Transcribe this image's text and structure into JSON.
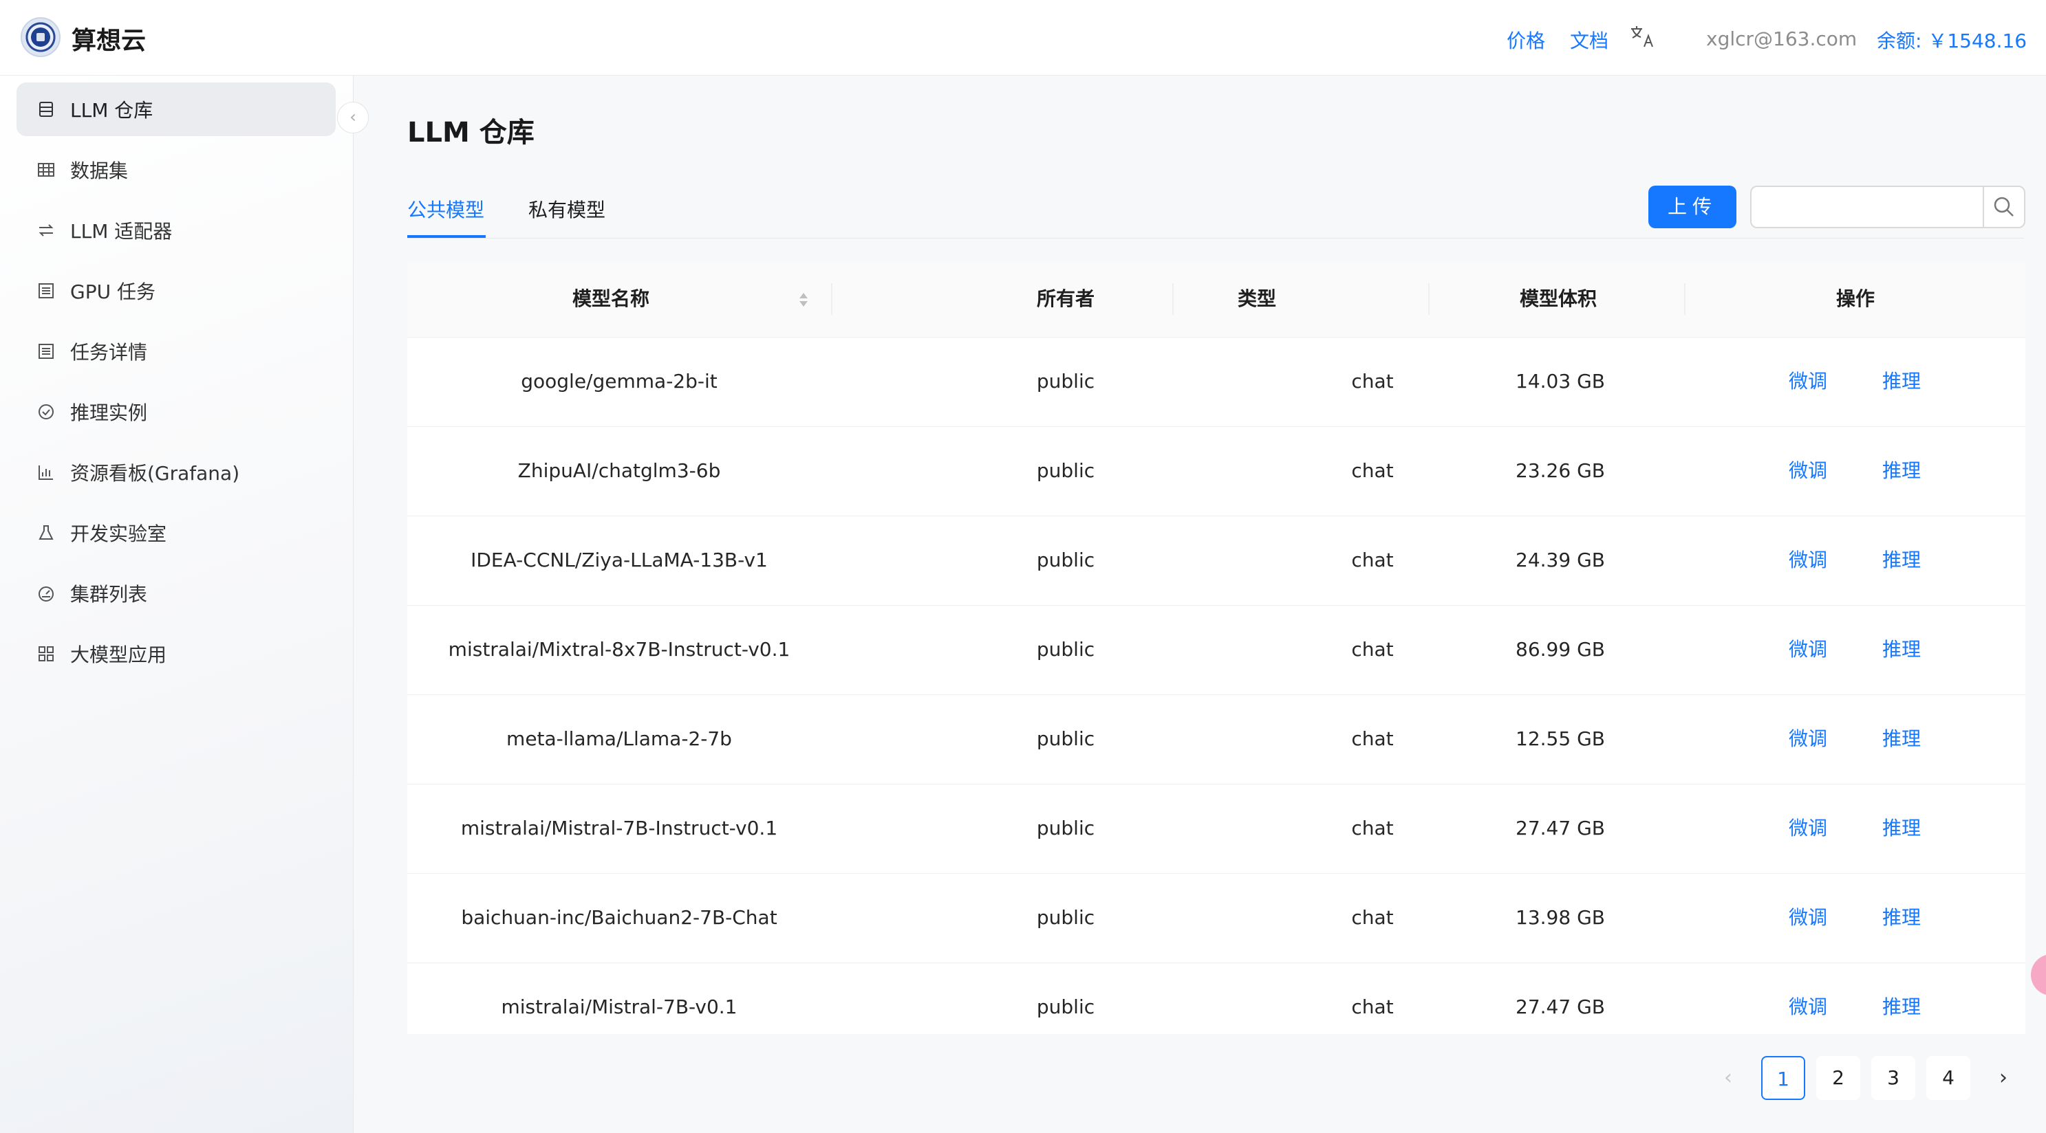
{
  "header": {
    "brand": "算想云",
    "links": [
      "价格",
      "文档"
    ],
    "account": "xglcr@163.com",
    "balance": "余额: ￥1548.16"
  },
  "sidebar": {
    "items": [
      {
        "label": "LLM 仓库",
        "icon": "database-icon",
        "active": true
      },
      {
        "label": "数据集",
        "icon": "table-icon",
        "active": false
      },
      {
        "label": "LLM 适配器",
        "icon": "swap-icon",
        "active": false
      },
      {
        "label": "GPU 任务",
        "icon": "list-icon",
        "active": false
      },
      {
        "label": "任务详情",
        "icon": "list-icon",
        "active": false
      },
      {
        "label": "推理实例",
        "icon": "check-circle-icon",
        "active": false
      },
      {
        "label": "资源看板(Grafana)",
        "icon": "bar-chart-icon",
        "active": false
      },
      {
        "label": "开发实验室",
        "icon": "flask-icon",
        "active": false
      },
      {
        "label": "集群列表",
        "icon": "dashboard-icon",
        "active": false
      },
      {
        "label": "大模型应用",
        "icon": "apps-icon",
        "active": false
      }
    ]
  },
  "main": {
    "title": "LLM 仓库",
    "tabs": [
      {
        "label": "公共模型",
        "active": true
      },
      {
        "label": "私有模型",
        "active": false
      }
    ],
    "upload_label": "上传",
    "search_value": ""
  },
  "table": {
    "columns": [
      "模型名称",
      "所有者",
      "类型",
      "模型体积",
      "操作"
    ],
    "actions": [
      "微调",
      "推理"
    ],
    "rows": [
      {
        "name": "google/gemma-2b-it",
        "owner": "public",
        "type": "chat",
        "size": "14.03 GB"
      },
      {
        "name": "ZhipuAI/chatglm3-6b",
        "owner": "public",
        "type": "chat",
        "size": "23.26 GB"
      },
      {
        "name": "IDEA-CCNL/Ziya-LLaMA-13B-v1",
        "owner": "public",
        "type": "chat",
        "size": "24.39 GB"
      },
      {
        "name": "mistralai/Mixtral-8x7B-Instruct-v0.1",
        "owner": "public",
        "type": "chat",
        "size": "86.99 GB"
      },
      {
        "name": "meta-llama/Llama-2-7b",
        "owner": "public",
        "type": "chat",
        "size": "12.55 GB"
      },
      {
        "name": "mistralai/Mistral-7B-Instruct-v0.1",
        "owner": "public",
        "type": "chat",
        "size": "27.47 GB"
      },
      {
        "name": "baichuan-inc/Baichuan2-7B-Chat",
        "owner": "public",
        "type": "chat",
        "size": "13.98 GB"
      },
      {
        "name": "mistralai/Mistral-7B-v0.1",
        "owner": "public",
        "type": "chat",
        "size": "27.47 GB"
      }
    ]
  },
  "pagination": {
    "pages": [
      "1",
      "2",
      "3",
      "4"
    ],
    "current": "1"
  },
  "colors": {
    "accent": "#1677ff",
    "sidebar_active_bg": "#ebecef"
  }
}
